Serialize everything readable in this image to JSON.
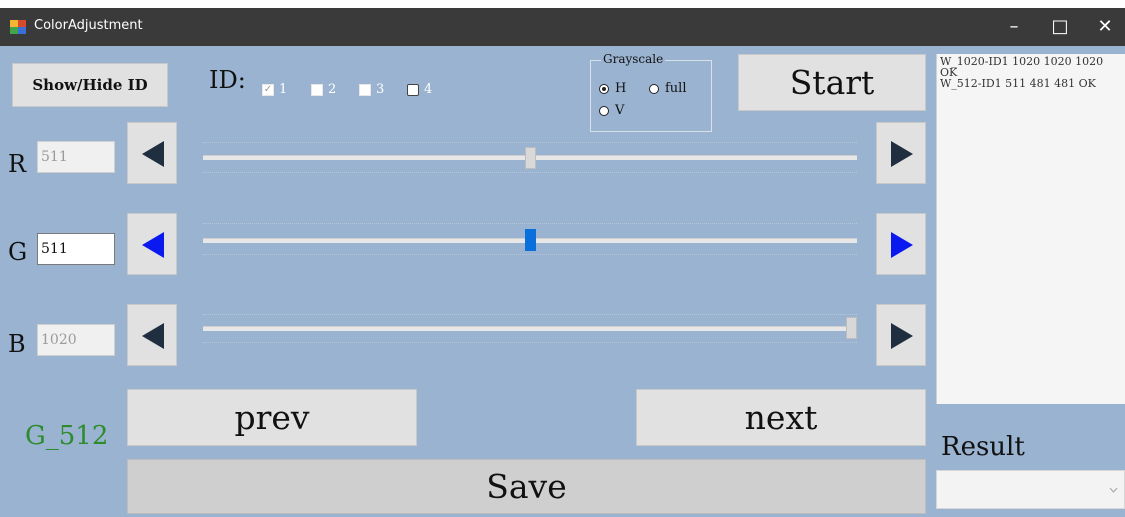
{
  "window": {
    "title": "ColorAdjustment",
    "minimize": "–",
    "maximize": "□",
    "close": "✕"
  },
  "toolbar": {
    "show_hide_id": "Show/Hide ID",
    "id_label": "ID:",
    "ids": [
      {
        "label": "1",
        "checked": true
      },
      {
        "label": "2",
        "checked": false
      },
      {
        "label": "3",
        "checked": false
      },
      {
        "label": "4",
        "checked": false
      }
    ],
    "start": "Start"
  },
  "grayscale": {
    "title": "Grayscale",
    "options": [
      {
        "label": "H",
        "selected": true
      },
      {
        "label": "full",
        "selected": false
      },
      {
        "label": "V",
        "selected": false
      }
    ]
  },
  "channels": [
    {
      "name": "R",
      "value": "511",
      "active": false,
      "level": 0.5
    },
    {
      "name": "G",
      "value": "511",
      "active": true,
      "level": 0.5
    },
    {
      "name": "B",
      "value": "1020",
      "active": false,
      "level": 1.0
    }
  ],
  "status": {
    "label": "G_512",
    "color": "#2e8b2e"
  },
  "nav": {
    "prev": "prev",
    "next": "next",
    "save": "Save"
  },
  "log": {
    "lines": [
      "W_1020-ID1  1020  1020  1020 OK",
      "W_512-ID1  511  481  481 OK"
    ]
  },
  "result": {
    "label": "Result",
    "value": ""
  },
  "colors": {
    "background": "#9ab3d1",
    "active_arrow": "#0a19f0",
    "inactive_arrow": "#1f2f40",
    "active_thumb": "#0a6fdc"
  }
}
